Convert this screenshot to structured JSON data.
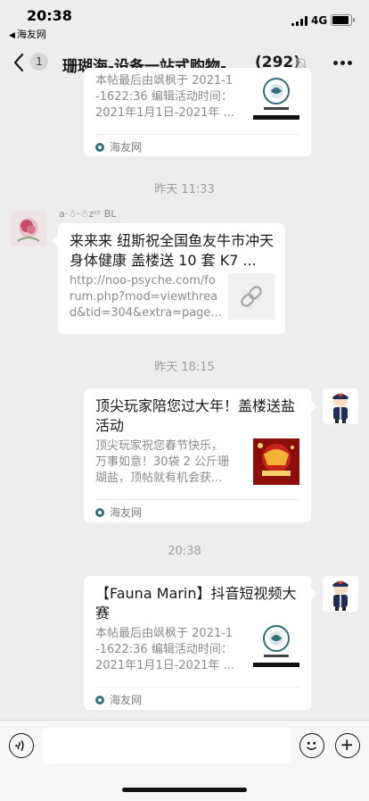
{
  "status_bar": {
    "time": "20:38",
    "back_app": "海友网",
    "network": "4G"
  },
  "nav": {
    "unread_count": "1",
    "title": "珊瑚海-设备一站式购物-...",
    "member_count": "(292)"
  },
  "messages": [
    {
      "type": "link_card",
      "side": "right",
      "title": "",
      "description": "本帖最后由飒枫于 2021-1\n-1622:36 编辑活动时间：\n2021年1月1日-2021年 ...",
      "source": "海友网",
      "thumbnail": "fauna-marin-logo"
    },
    {
      "type": "timestamp",
      "text": "昨天 11:33"
    },
    {
      "type": "link_card",
      "side": "left",
      "sender": "a·☃·☃zᶻᶻ BL",
      "title": "来来来 纽斯祝全国鱼友牛市冲天 身体健康 盖楼送 10 套 K7 ...",
      "description": "http://noo-psyche.com/fo\nrum.php?mod=viewthrea\nd&tid=304&extra=page...",
      "thumbnail": "link-icon"
    },
    {
      "type": "timestamp",
      "text": "昨天 18:15"
    },
    {
      "type": "link_card",
      "side": "right",
      "title": "顶尖玩家陪您过大年！盖楼送盐活动",
      "description": "顶尖玩家祝您春节快乐，\n万事如意！30袋 2 公斤珊\n瑚盐，顶帖就有机会获...",
      "source": "海友网",
      "thumbnail": "new-year-poster"
    },
    {
      "type": "timestamp",
      "text": "20:38"
    },
    {
      "type": "link_card",
      "side": "right",
      "title": "【Fauna Marin】抖音短视频大赛",
      "description": "本帖最后由飒枫于 2021-1\n-1622:36 编辑活动时间：\n2021年1月1日-2021年 ...",
      "source": "海友网",
      "thumbnail": "fauna-marin-logo"
    }
  ],
  "colors": {
    "background": "#ededed",
    "card": "#ffffff",
    "timestamp": "#9d9d9d"
  },
  "icons": [
    "back-chevron-icon",
    "mute-icon",
    "more-icon",
    "voice-icon",
    "emoji-icon",
    "plus-icon",
    "link-icon",
    "source-icon"
  ]
}
